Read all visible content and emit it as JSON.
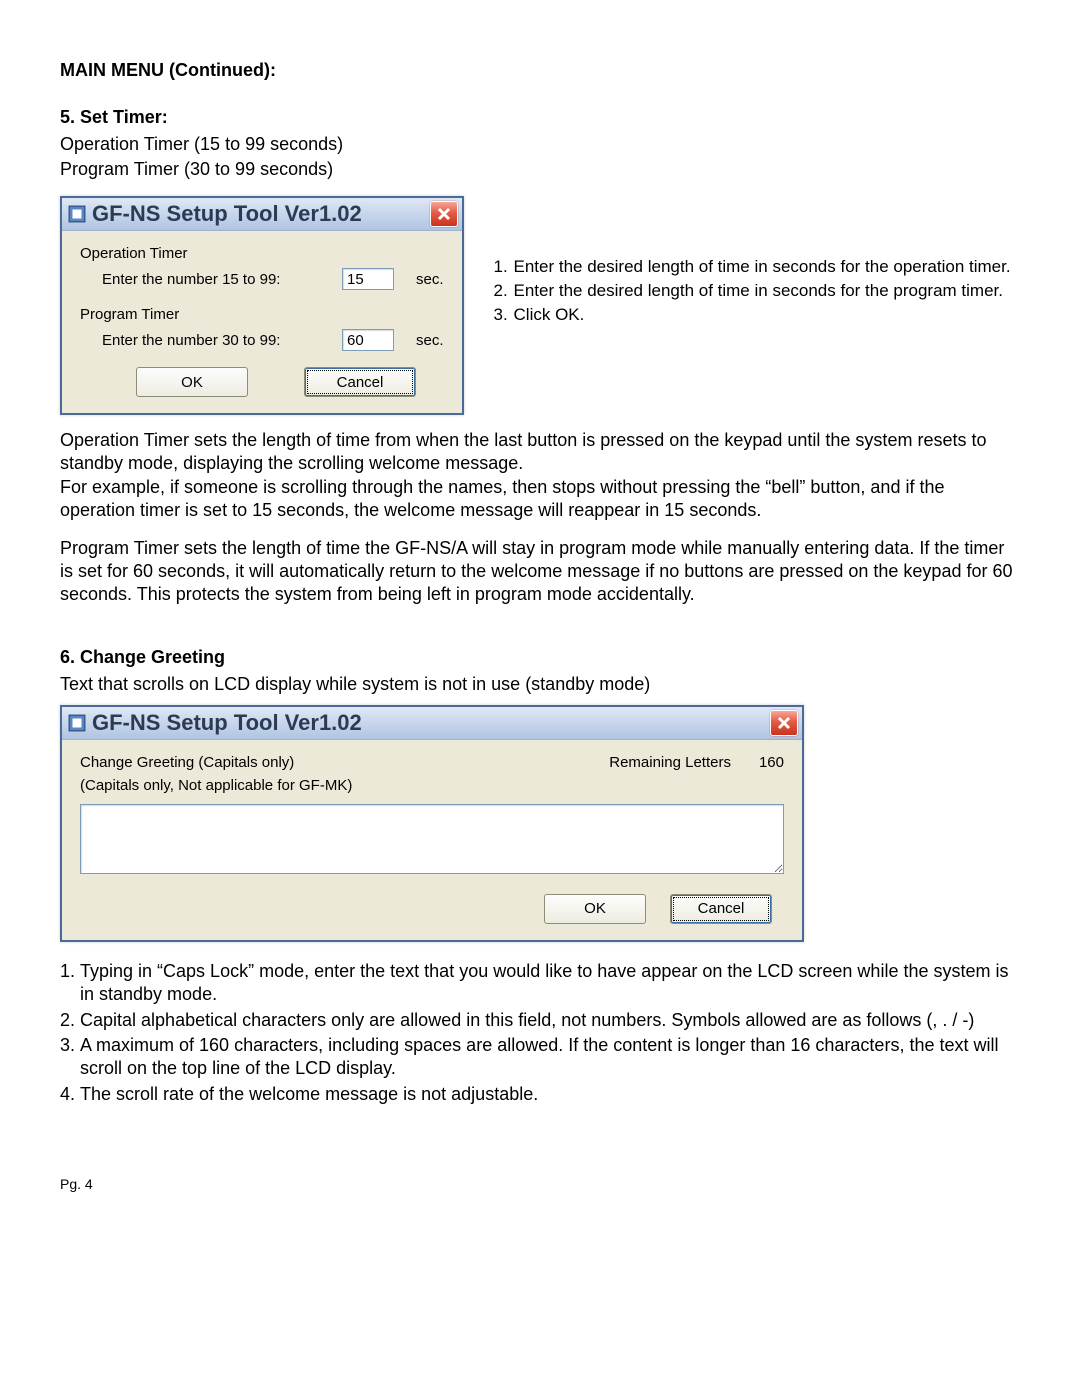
{
  "header": {
    "main_title": "MAIN MENU (Continued):",
    "section5_title": "5. Set Timer:",
    "op_timer_range": "Operation Timer (15 to 99 seconds)",
    "prog_timer_range": "Program Timer (30 to 99 seconds)"
  },
  "dialog1": {
    "title": "GF-NS Setup Tool Ver1.02",
    "op_timer_label": "Operation Timer",
    "op_timer_prompt": "Enter the number 15 to 99:",
    "op_timer_value": "15",
    "op_timer_unit": "sec.",
    "prog_timer_label": "Program Timer",
    "prog_timer_prompt": "Enter the number 30 to 99:",
    "prog_timer_value": "60",
    "prog_timer_unit": "sec.",
    "ok_label": "OK",
    "cancel_label": "Cancel"
  },
  "instr1": {
    "i1": "Enter the desired  length of time in seconds for the operation timer.",
    "i2": "Enter the desired  length of time in seconds for the program timer.",
    "i3": "Click OK."
  },
  "para1": "Operation Timer sets the length of time from when the last button is pressed on the keypad until the system resets to standby mode, displaying the scrolling welcome message.",
  "para2": "For example, if someone is scrolling through the names, then stops without pressing the “bell” button, and if the operation timer is set to 15 seconds, the welcome message will reappear in 15 seconds.",
  "para3": "Program Timer sets the length of time the GF-NS/A will stay in program mode while manually entering data. If the timer is set for 60 seconds, it will automatically return to the welcome message if no buttons are pressed on the keypad for 60 seconds. This protects the system from being left in program mode accidentally.",
  "section6": {
    "title": "6. Change Greeting",
    "subtitle": "Text that scrolls on LCD display while system is not in use (standby mode)"
  },
  "dialog2": {
    "title": "GF-NS Setup Tool Ver1.02",
    "main_label": "Change Greeting (Capitals only)",
    "note_label": "(Capitals only, Not applicable for GF-MK)",
    "remaining_label": "Remaining Letters",
    "remaining_value": "160",
    "textarea_value": "",
    "ok_label": "OK",
    "cancel_label": "Cancel"
  },
  "instr2": {
    "i1": "Typing in “Caps Lock” mode, enter the text that you would like to have appear on the LCD screen while the system is in standby mode.",
    "i2": "Capital alphabetical characters only are allowed in this field, not numbers. Symbols allowed are as follows (, . / -)",
    "i3": "A maximum of 160 characters, including spaces are allowed. If the content is longer than 16 characters, the text will scroll on the top line of the LCD display.",
    "i4": "The scroll rate of the welcome message is not adjustable."
  },
  "footer": "Pg. 4"
}
